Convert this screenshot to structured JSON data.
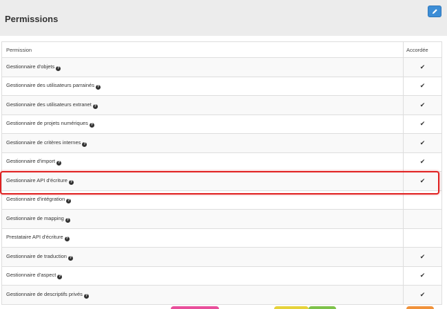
{
  "panel": {
    "title": "Permissions",
    "edit_button_icon": "pencil-icon"
  },
  "table": {
    "headers": {
      "permission": "Permission",
      "granted": "Accordée"
    },
    "rows": [
      {
        "label": "Gestionnaire d'objets",
        "granted": true
      },
      {
        "label": "Gestionnaire des utilisateurs parrainés",
        "granted": true
      },
      {
        "label": "Gestionnaire des utilisateurs extranet",
        "granted": true
      },
      {
        "label": "Gestionnaire de projets numériques",
        "granted": true
      },
      {
        "label": "Gestionnaire de critères internes",
        "granted": true
      },
      {
        "label": "Gestionnaire d'import",
        "granted": true
      },
      {
        "label": "Gestionnaire API d'écriture",
        "granted": true
      },
      {
        "label": "Gestionnaire d'intégration",
        "granted": false
      },
      {
        "label": "Gestionnaire de mapping",
        "granted": false
      },
      {
        "label": "Prestataire API d'écriture",
        "granted": false
      },
      {
        "label": "Gestionnaire de traduction",
        "granted": true
      },
      {
        "label": "Gestionnaire d'aspect",
        "granted": true
      },
      {
        "label": "Gestionnaire de descriptifs privés",
        "granted": true
      }
    ],
    "help_icon_glyph": "?",
    "check_glyph": "✔"
  },
  "colors": {
    "header_bg": "#ececec",
    "edit_button": "#3c8dd6",
    "highlight": "#e02020"
  }
}
